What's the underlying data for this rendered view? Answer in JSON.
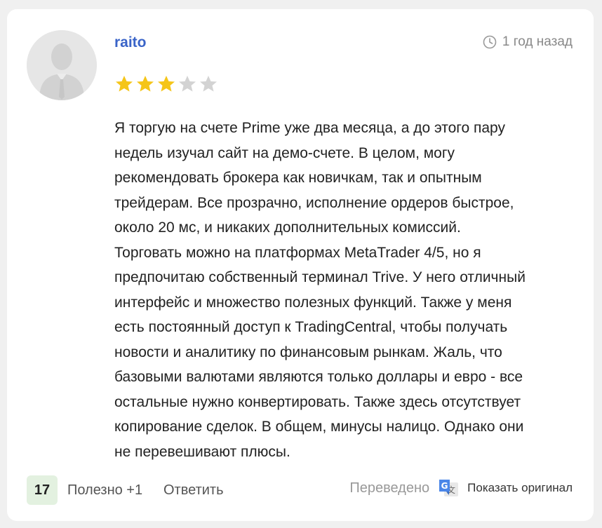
{
  "review": {
    "username": "raito",
    "time_ago": "1 год назад",
    "rating": 3,
    "rating_max": 5,
    "text": "Я торгую на счете Prime уже два месяца, а до этого пару\nнедель изучал сайт на демо-счете. В целом, могу\nрекомендовать брокера как новичкам, так и опытным\nтрейдерам. Все прозрачно, исполнение ордеров быстрое,\nоколо 20 мс, и никаких дополнительных комиссий.\nТорговать можно на платформах MetaTrader 4/5, но я\nпредпочитаю собственный терминал Trive. У него отличный\nинтерфейс и множество полезных функций. Также у меня\nесть постоянный доступ к TradingCentral, чтобы получать\nновости и аналитику по финансовым рынкам. Жаль, что\nбазовыми валютами являются только доллары и евро - все\nостальные нужно конвертировать. Также здесь отсутствует\nкопирование сделок. В общем, минусы налицо. Однако они\nне перевешивают плюсы."
  },
  "footer": {
    "helpful_count": "17",
    "helpful_label": "Полезно +1",
    "reply_label": "Ответить",
    "translated_label": "Переведено",
    "show_original_label": "Показать оригинал"
  },
  "icons": {
    "avatar": "default-user-avatar-icon",
    "clock": "clock-icon",
    "star": "star-icon",
    "translate": "google-translate-icon"
  },
  "colors": {
    "username": "#3a64c8",
    "star_filled": "#f5c518",
    "star_empty": "#d3d3d3",
    "helpful_badge_bg": "#e3f1e0"
  }
}
